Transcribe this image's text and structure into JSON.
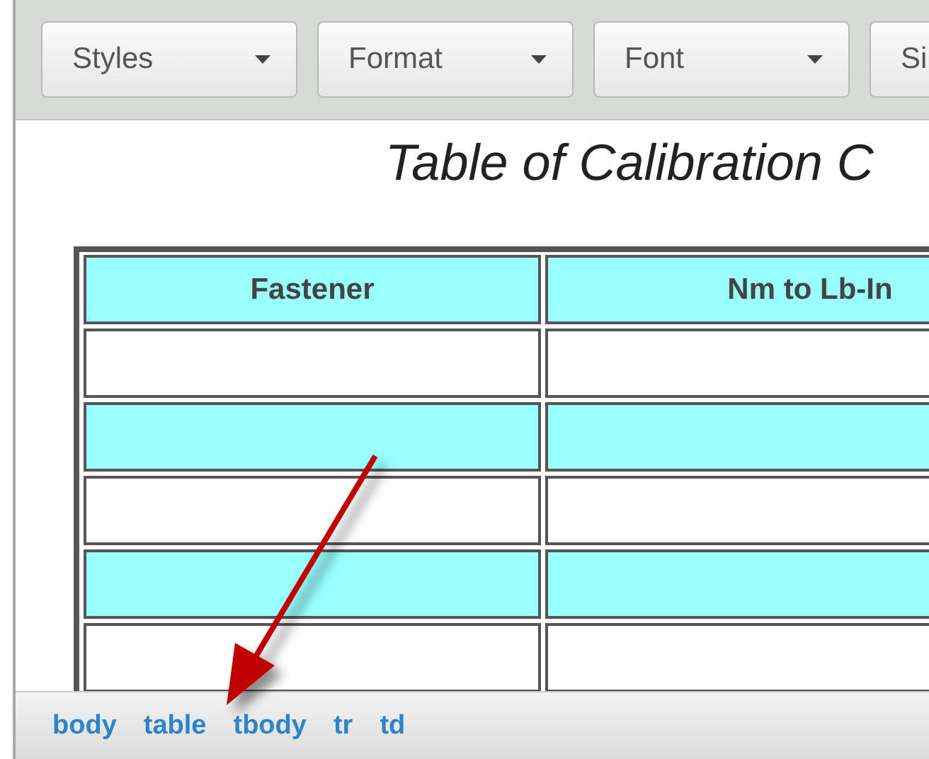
{
  "toolbar": {
    "dropdowns": [
      {
        "label": "Styles"
      },
      {
        "label": "Format"
      },
      {
        "label": "Font"
      },
      {
        "label": "Si"
      }
    ]
  },
  "document": {
    "title": "Table of Calibration C",
    "table": {
      "columns": [
        "Fastener",
        "Nm to Lb-In"
      ],
      "rows": [
        {
          "shaded": false
        },
        {
          "shaded": true
        },
        {
          "shaded": false
        },
        {
          "shaded": true
        },
        {
          "shaded": false
        }
      ]
    }
  },
  "status_bar": {
    "path": [
      "body",
      "table",
      "tbody",
      "tr",
      "td"
    ]
  }
}
